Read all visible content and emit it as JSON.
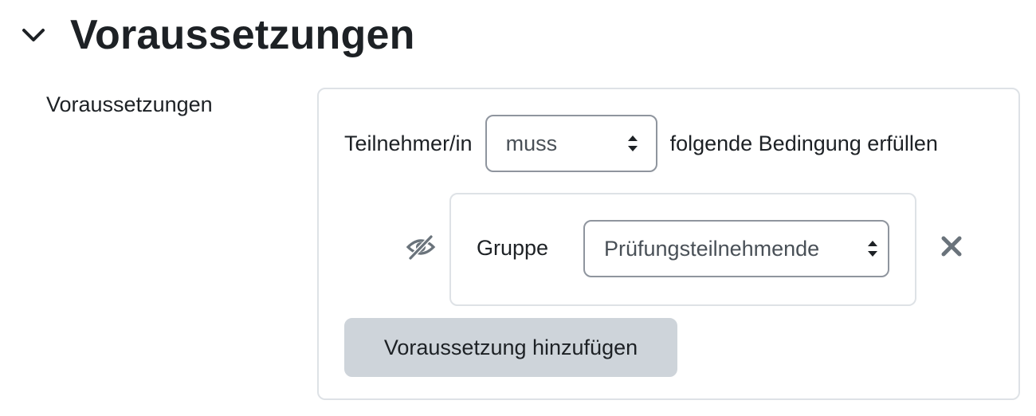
{
  "section": {
    "title": "Voraussetzungen",
    "toggle_icon": "chevron-down-icon"
  },
  "field": {
    "label": "Voraussetzungen"
  },
  "rule": {
    "prefix": "Teilnehmer/in",
    "requirement_select": {
      "selected": "muss"
    },
    "suffix": "folgende Bedingung erfüllen"
  },
  "condition": {
    "visibility_icon": "eye-slash-icon",
    "type_label": "Gruppe",
    "group_select": {
      "selected": "Prüfungsteilnehmende"
    },
    "delete_icon": "close-icon"
  },
  "add_button": {
    "label": "Voraussetzung hinzufügen"
  },
  "colors": {
    "text": "#1d2125",
    "border": "#dee2e6",
    "select_border": "#8f959e",
    "button_bg": "#ced4da",
    "icon_gray": "#6a737b"
  }
}
